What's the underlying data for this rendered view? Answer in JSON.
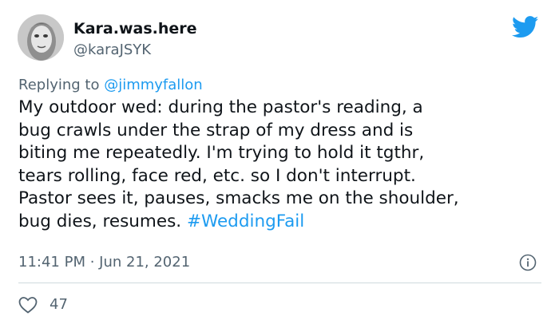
{
  "colors": {
    "accent": "#1d9bf0",
    "text": "#0f1419",
    "muted": "#536471",
    "divider": "#cfd9de"
  },
  "author": {
    "display_name": "Kara.was.here",
    "handle": "@karaJSYK",
    "avatar_icon": "profile-photo"
  },
  "brand_icon": "twitter-bird-icon",
  "reply": {
    "prefix": "Replying to ",
    "mention": "@jimmyfallon"
  },
  "tweet": {
    "lines": [
      "My outdoor wed: during the pastor's reading, a",
      "bug crawls under the strap of my dress and is",
      "biting me repeatedly. I'm trying to hold it tgthr,",
      "tears rolling, face red, etc. so I don't interrupt.",
      "Pastor sees it, pauses, smacks me on the shoulder,",
      "bug dies, resumes. "
    ],
    "hashtag": "#WeddingFail"
  },
  "meta": {
    "time": "11:41 PM",
    "separator": " · ",
    "date": "Jun 21, 2021"
  },
  "info_icon": "info-icon",
  "likes": {
    "icon": "heart-icon",
    "count": "47"
  }
}
